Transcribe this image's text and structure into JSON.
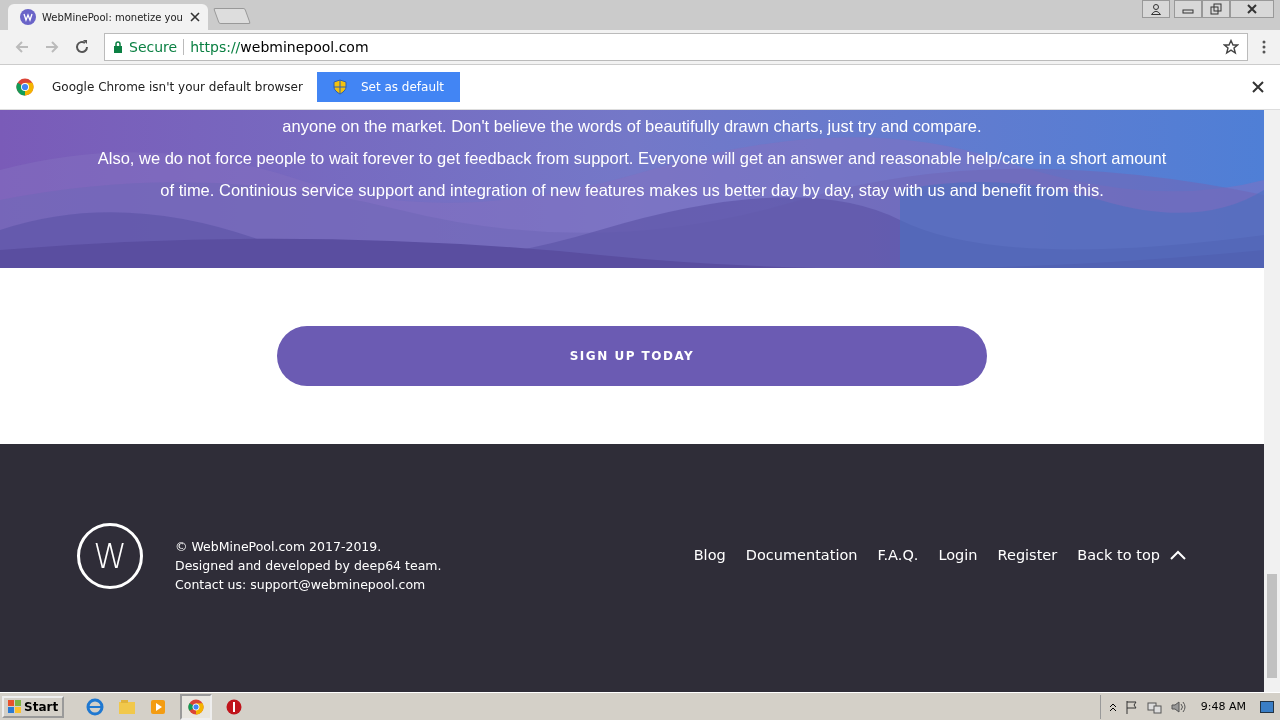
{
  "browser": {
    "tabs": [
      {
        "title": "WebMinePool: monetize you",
        "selected": true
      }
    ],
    "security": "Secure",
    "url_scheme": "https://",
    "url_host": "webminepool.com"
  },
  "infobar": {
    "message": "Google Chrome isn't your default browser",
    "button": "Set as default"
  },
  "hero": {
    "lines": [
      "anyone on the market. Don't believe the words of beautifully drawn charts, just try and compare.",
      "Also, we do not force people to wait forever to get feedback from support. Everyone will get an answer and reasonable help/care in a short amount",
      "of time. Continious service support and integration of new features makes us better day by day, stay with us and benefit from this."
    ]
  },
  "signup_button": "SIGN UP TODAY",
  "footer": {
    "logo": "W",
    "info": [
      "© WebMinePool.com 2017-2019.",
      "Designed and developed by deep64 team.",
      "Contact us: support@webminepool.com"
    ],
    "links": [
      "Blog",
      "Documentation",
      "F.A.Q.",
      "Login",
      "Register"
    ],
    "back_to_top": "Back to top"
  },
  "taskbar": {
    "start": "Start",
    "clock": "9:48 AM"
  }
}
